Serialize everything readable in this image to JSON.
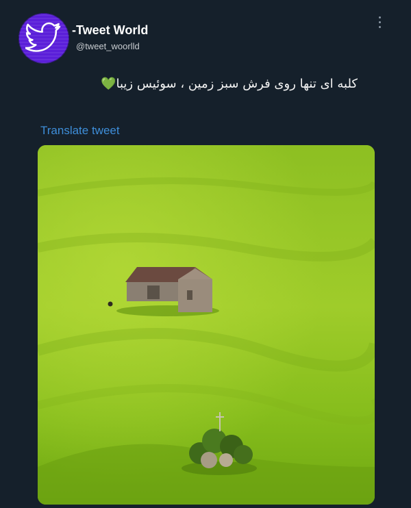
{
  "author": {
    "display_name": "-Tweet World",
    "handle": "@tweet_woorlld",
    "avatar_icon": "twitter-bird-icon"
  },
  "menu_icon": "more-vertical-icon",
  "tweet": {
    "text": "کلبه ای تنها روی فرش سبز زمین ، سوئیس زیبا",
    "emoji": "💚",
    "translate_label": "Translate tweet"
  },
  "media": {
    "type": "photo",
    "subject": "lone cabin on green hillside"
  },
  "colors": {
    "background": "#15202b",
    "link": "#3e8ed9",
    "avatar": "#5b1fd9",
    "grass": "#8cc21f"
  }
}
